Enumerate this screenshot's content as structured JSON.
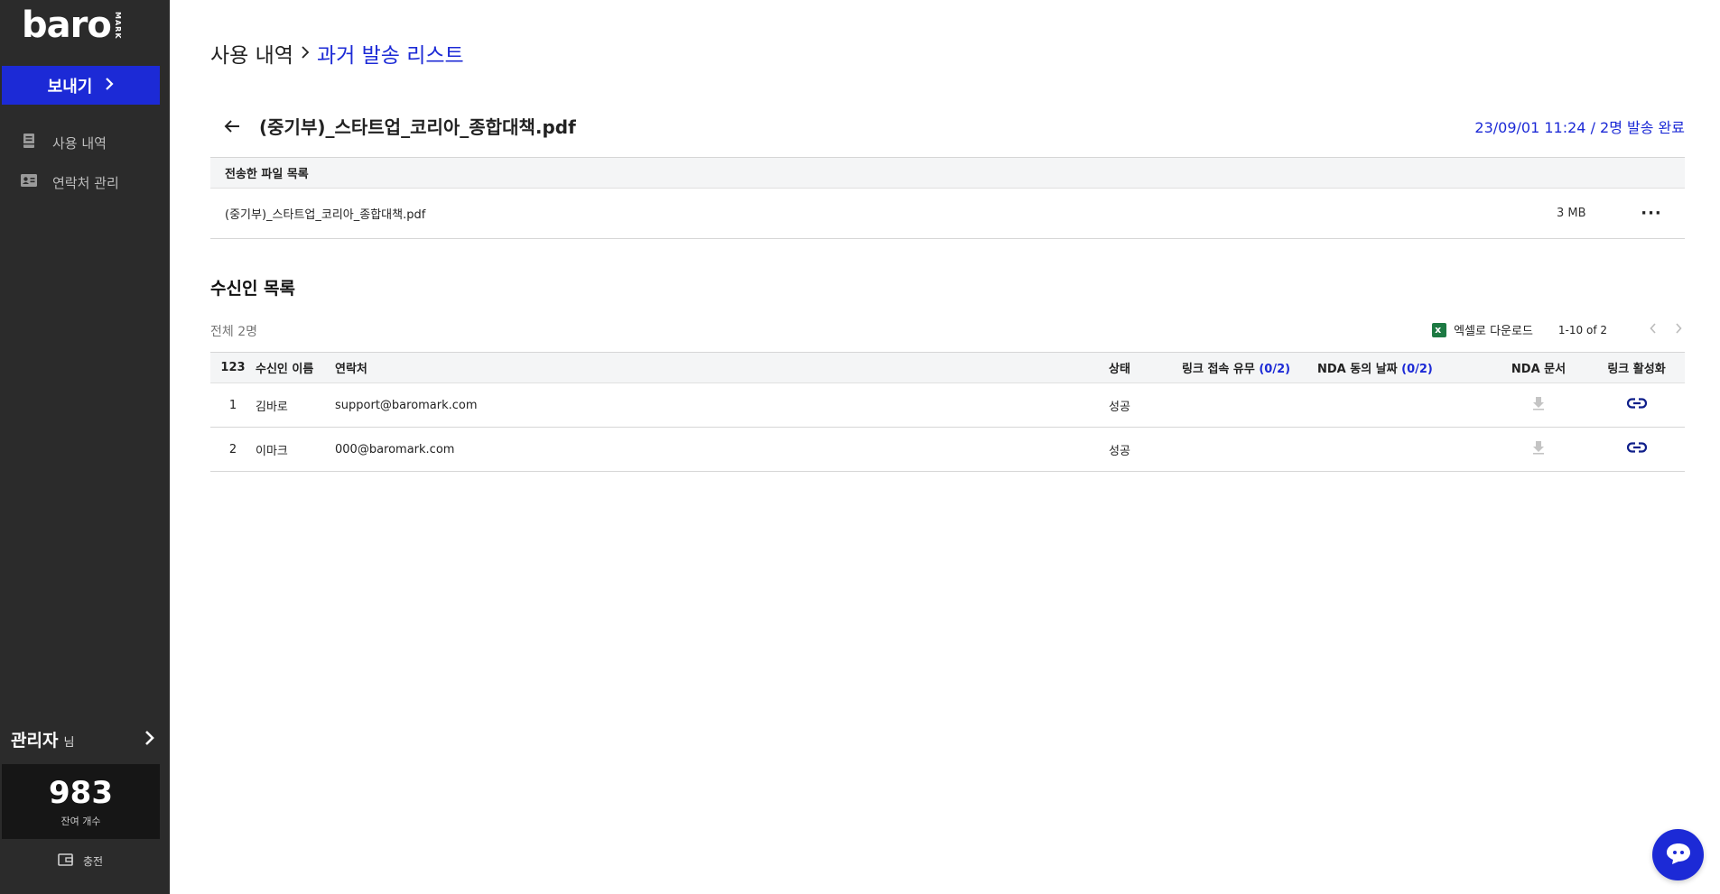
{
  "sidebar": {
    "logo_word": "baro",
    "logo_sub": "MARK",
    "send_label": "보내기",
    "nav": [
      {
        "label": "사용 내역",
        "icon": "document-icon"
      },
      {
        "label": "연락처 관리",
        "icon": "contact-card-icon"
      }
    ],
    "admin_name": "관리자",
    "admin_suffix": "님",
    "credits": "983",
    "credits_label": "잔여 개수",
    "charge_label": "충전"
  },
  "breadcrumb": {
    "root": "사용 내역",
    "current": "과거 발송 리스트"
  },
  "file_header": {
    "title": "(중기부)_스타트업_코리아_종합대책.pdf",
    "send_info": "23/09/01 11:24 / 2명 발송 완료"
  },
  "files_table": {
    "header": "전송한 파일 목록",
    "rows": [
      {
        "name": "(중기부)_스타트업_코리아_종합대책.pdf",
        "size": "3 MB",
        "more": "···"
      }
    ]
  },
  "recipients": {
    "title": "수신인 목록",
    "total": "전체 2명",
    "excel_label": "엑셀로 다운로드",
    "page_range": "1-10 of 2",
    "columns": {
      "num": "123",
      "name": "수신인 이름",
      "contact": "연락처",
      "status": "상태",
      "link_access": "링크 접속 유무",
      "link_access_count": "(0/2)",
      "nda_date": "NDA 동의 날짜",
      "nda_date_count": "(0/2)",
      "nda_doc": "NDA 문서",
      "link_activate": "링크 활성화"
    },
    "rows": [
      {
        "num": "1",
        "name": "김바로",
        "contact": "support@baromark.com",
        "status": "성공"
      },
      {
        "num": "2",
        "name": "이마크",
        "contact": "000@baromark.com",
        "status": "성공"
      }
    ]
  },
  "colors": {
    "accent": "#1c2ad6",
    "sidebar_bg": "#2b2b2b",
    "excel_green": "#1d7a43"
  }
}
